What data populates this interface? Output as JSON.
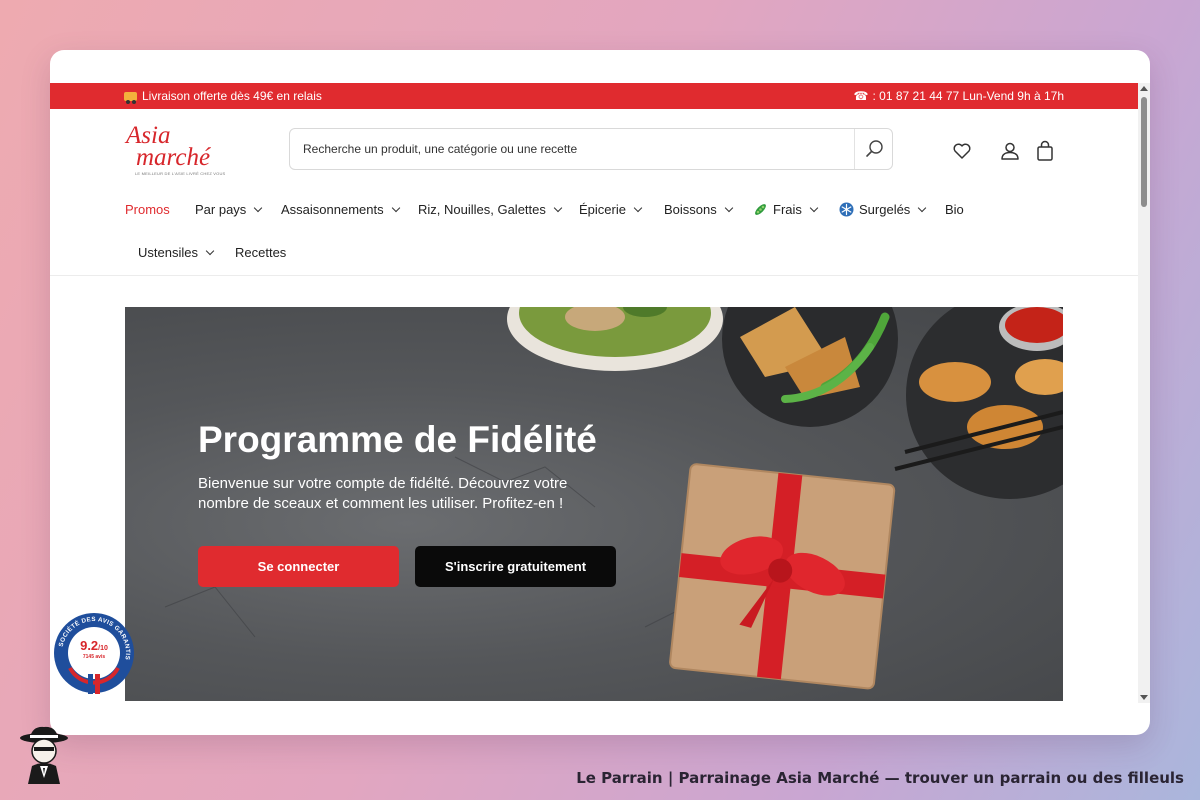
{
  "topbar": {
    "delivery_text": "Livraison offerte dès 49€ en relais",
    "contact_text": ": 01 87 21 44 77 Lun-Vend 9h à 17h",
    "background": "#e02b2f"
  },
  "logo": {
    "line1": "Asia",
    "line2": "marché",
    "tagline": "LE MEILLEUR DE L'ASIE LIVRÉ CHEZ VOUS"
  },
  "search": {
    "placeholder": "Recherche un produit, une catégorie ou une recette"
  },
  "header_icons": [
    "heart-icon",
    "account-icon",
    "cart-icon"
  ],
  "nav": {
    "promos": "Promos",
    "par_pays": "Par pays",
    "assaisonnements": "Assaisonnements",
    "riz": "Riz, Nouilles, Galettes",
    "epicerie": "Épicerie",
    "boissons": "Boissons",
    "frais": "Frais",
    "surgeles": "Surgelés",
    "bio": "Bio",
    "ustensiles": "Ustensiles",
    "recettes": "Recettes"
  },
  "hero": {
    "title": "Programme de Fidélité",
    "description": "Bienvenue sur votre compte de fidélté. Découvrez votre nombre de sceaux et comment les utiliser. Profitez-en !",
    "login_button": "Se connecter",
    "signup_button": "S'inscrire gratuitement"
  },
  "reviews_badge": {
    "ring_text": "SOCIÉTÉ DES AVIS GARANTIS",
    "score": "9.2",
    "scale": "/10",
    "count": "7145 avis"
  },
  "caption": "Le Parrain | Parrainage Asia Marché — trouver un parrain ou des filleuls",
  "colors": {
    "accent_red": "#e02b2f",
    "button_black": "#0a0a0a"
  }
}
